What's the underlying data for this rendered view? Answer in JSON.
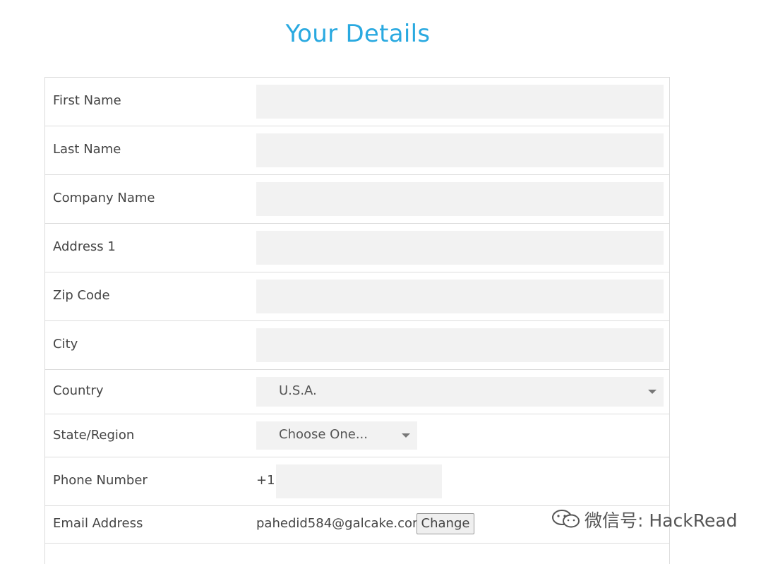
{
  "page": {
    "title": "Your Details"
  },
  "form": {
    "first_name": {
      "label": "First Name",
      "value": ""
    },
    "last_name": {
      "label": "Last Name",
      "value": ""
    },
    "company_name": {
      "label": "Company Name",
      "value": ""
    },
    "address1": {
      "label": "Address 1",
      "value": ""
    },
    "zip_code": {
      "label": "Zip Code",
      "value": ""
    },
    "city": {
      "label": "City",
      "value": ""
    },
    "country": {
      "label": "Country",
      "selected": "U.S.A."
    },
    "state": {
      "label": "State/Region",
      "selected": "Choose One..."
    },
    "phone": {
      "label": "Phone Number",
      "prefix": "+1",
      "value": ""
    },
    "email": {
      "label": "Email Address",
      "value": "pahedid584@galcake.com",
      "change_label": "Change"
    }
  },
  "watermark": {
    "text": "微信号: HackRead",
    "icon": "wechat-icon"
  }
}
